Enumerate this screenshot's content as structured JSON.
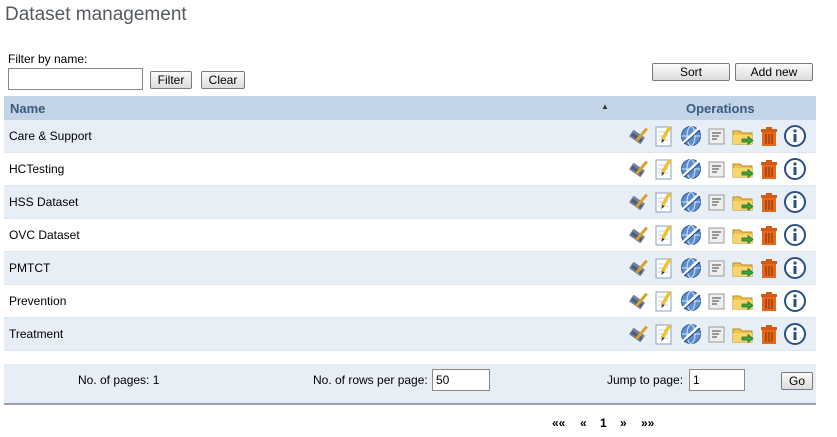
{
  "page": {
    "title": "Dataset management"
  },
  "filter": {
    "label": "Filter by name:",
    "value": "",
    "placeholder": "",
    "filter_button": "Filter",
    "clear_button": "Clear"
  },
  "toolbar": {
    "sort_button": "Sort",
    "add_button": "Add new"
  },
  "table": {
    "columns": [
      "Name",
      "Operations"
    ],
    "sort_indicator": "▲",
    "rows": [
      {
        "name": "Care & Support"
      },
      {
        "name": "HCTesting"
      },
      {
        "name": "HSS Dataset"
      },
      {
        "name": "OVC Dataset"
      },
      {
        "name": "PMTCT"
      },
      {
        "name": "Prevention"
      },
      {
        "name": "Treatment"
      }
    ],
    "operation_icons": [
      "broom-edit-icon",
      "edit-pencil-icon",
      "translate-globe-icon",
      "document-icon",
      "folder-move-icon",
      "trash-icon",
      "info-icon"
    ]
  },
  "pager": {
    "pages_label": "No. of pages: 1",
    "rows_label": "No. of rows per page:",
    "rows_value": "50",
    "jump_label": "Jump to page:",
    "jump_value": "1",
    "go_button": "Go",
    "first": "««",
    "prev": "«",
    "current": "1",
    "next": "»",
    "last": "»»"
  },
  "colors": {
    "header_bg": "#c3d4e6",
    "header_text": "#3a5a7f",
    "row_alt": "#e8eef5",
    "title": "#555a60"
  }
}
